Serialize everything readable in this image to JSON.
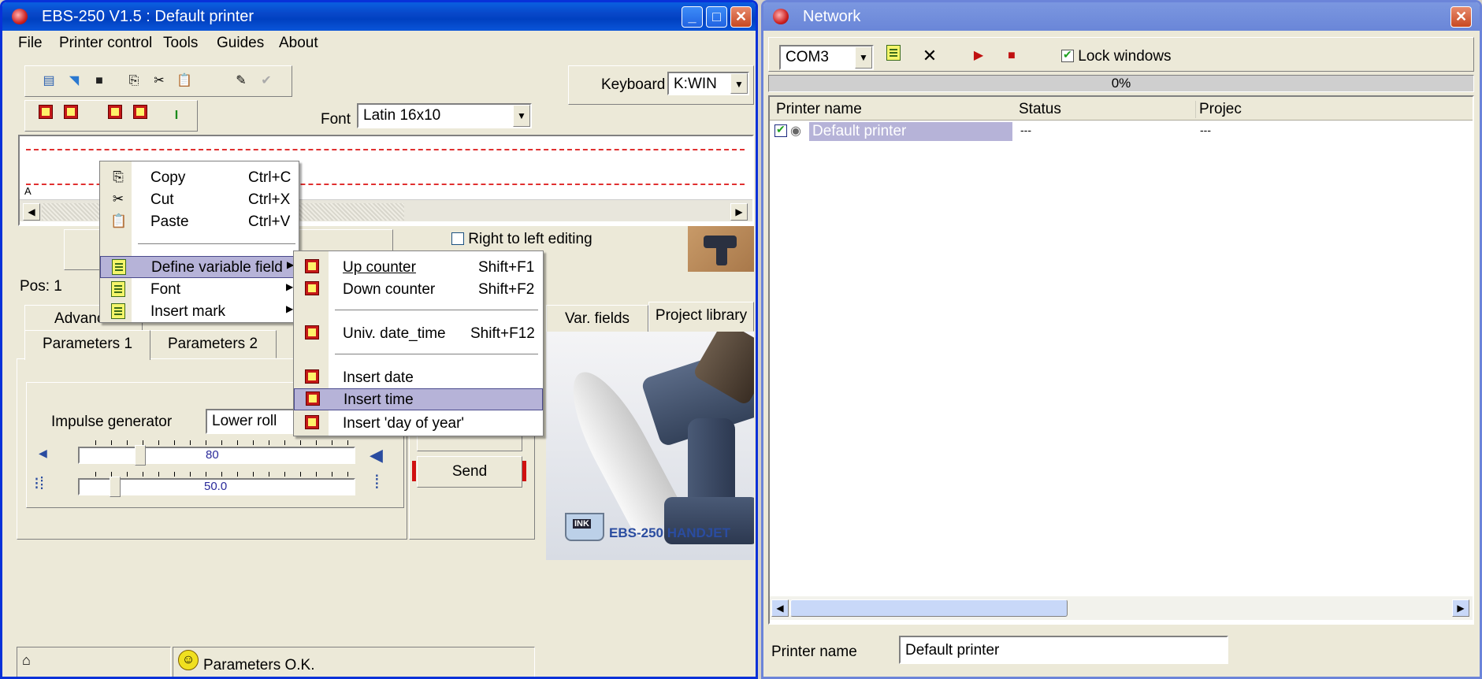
{
  "main_window": {
    "title": "EBS-250 V1.5  :  Default printer",
    "menu": [
      "File",
      "Printer control",
      "Tools",
      "Guides",
      "About"
    ],
    "keyboard_label": "Keyboard",
    "keyboard_value": "K:WIN",
    "font_label": "Font",
    "font_value": "Latin 16x10",
    "editor_marker": "A",
    "right_to_left_label": "Right to left editing",
    "pos_label": "Pos: 1",
    "tabs_row1": [
      "Advance",
      "Var. fields",
      "Project library"
    ],
    "tabs_row2": [
      "Parameters 1",
      "Parameters 2"
    ],
    "impulse_label": "Impulse generator",
    "impulse_value": "Lower roll",
    "slider1_value": "80",
    "slider2_value": "50.0",
    "send_label": "Send",
    "status_text": "Parameters O.K.",
    "product_caption": "EBS-250  HANDJET",
    "ink_label": "INK"
  },
  "context_menu": {
    "items": [
      {
        "label": "Copy",
        "shortcut": "Ctrl+C",
        "icon": "copy-icon"
      },
      {
        "label": "Cut",
        "shortcut": "Ctrl+X",
        "icon": "scissors-icon"
      },
      {
        "label": "Paste",
        "shortcut": "Ctrl+V",
        "icon": "paste-icon"
      },
      {
        "label": "Define variable field",
        "shortcut": "",
        "icon": "note-icon"
      },
      {
        "label": "Font",
        "shortcut": "",
        "icon": "note-icon"
      },
      {
        "label": "Insert mark",
        "shortcut": "",
        "icon": "note-icon"
      }
    ]
  },
  "submenu": {
    "items": [
      {
        "label": "Up counter",
        "shortcut": "Shift+F1"
      },
      {
        "label": "Down counter",
        "shortcut": "Shift+F2"
      },
      {
        "label": "Univ. date_time",
        "shortcut": "Shift+F12"
      },
      {
        "label": "Insert date",
        "shortcut": ""
      },
      {
        "label": "Insert time",
        "shortcut": ""
      },
      {
        "label": "Insert 'day of year'",
        "shortcut": ""
      }
    ]
  },
  "network_window": {
    "title": "Network",
    "port_value": "COM3",
    "lock_windows_label": "Lock windows",
    "progress_text": "0%",
    "columns": [
      "Printer name",
      "Status",
      "Projec"
    ],
    "rows": [
      {
        "name": "Default printer",
        "status": "---",
        "project": "---"
      }
    ],
    "printer_name_label": "Printer name",
    "printer_name_value": "Default printer"
  },
  "colors": {
    "titlebar": "#0a5fe0",
    "highlight": "#b6b3d8",
    "window_bg": "#ece9d8"
  }
}
